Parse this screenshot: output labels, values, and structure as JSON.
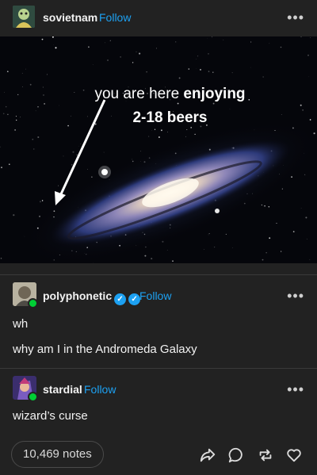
{
  "post": {
    "author": "sovietnam",
    "follow_label": "Follow",
    "more_label": "•••",
    "image": {
      "caption_line1_normal": "you are here ",
      "caption_line1_bold": "enjoying",
      "caption_line2_bold": "2-18 beers"
    }
  },
  "reblogs": [
    {
      "author": "polyphonetic",
      "follow_label": "Follow",
      "more_label": "•••",
      "lines": [
        "wh",
        "why am I in the Andromeda Galaxy"
      ]
    },
    {
      "author": "stardial",
      "follow_label": "Follow",
      "more_label": "•••",
      "lines": [
        "wizard’s curse"
      ]
    }
  ],
  "footer": {
    "notes_label": "10,469 notes",
    "actions": [
      "share-icon",
      "reply-icon",
      "reblog-icon",
      "like-icon"
    ]
  },
  "colors": {
    "background": "#222222",
    "follow": "#1da1f2",
    "reblog_badge": "#00cf35"
  }
}
